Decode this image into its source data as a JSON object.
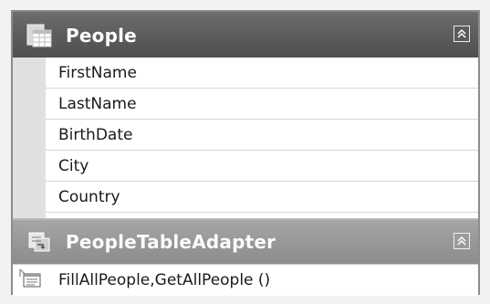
{
  "table": {
    "title": "People",
    "columns": [
      {
        "name": "FirstName"
      },
      {
        "name": "LastName"
      },
      {
        "name": "BirthDate"
      },
      {
        "name": "City"
      },
      {
        "name": "Country"
      }
    ]
  },
  "adapter": {
    "title": "PeopleTableAdapter",
    "method": "FillAllPeople,GetAllPeople ()"
  },
  "icons": {
    "table": "datatable-icon",
    "adapter": "tableadapter-icon",
    "method": "query-method-icon",
    "collapse": "collapse-chevron-icon"
  }
}
